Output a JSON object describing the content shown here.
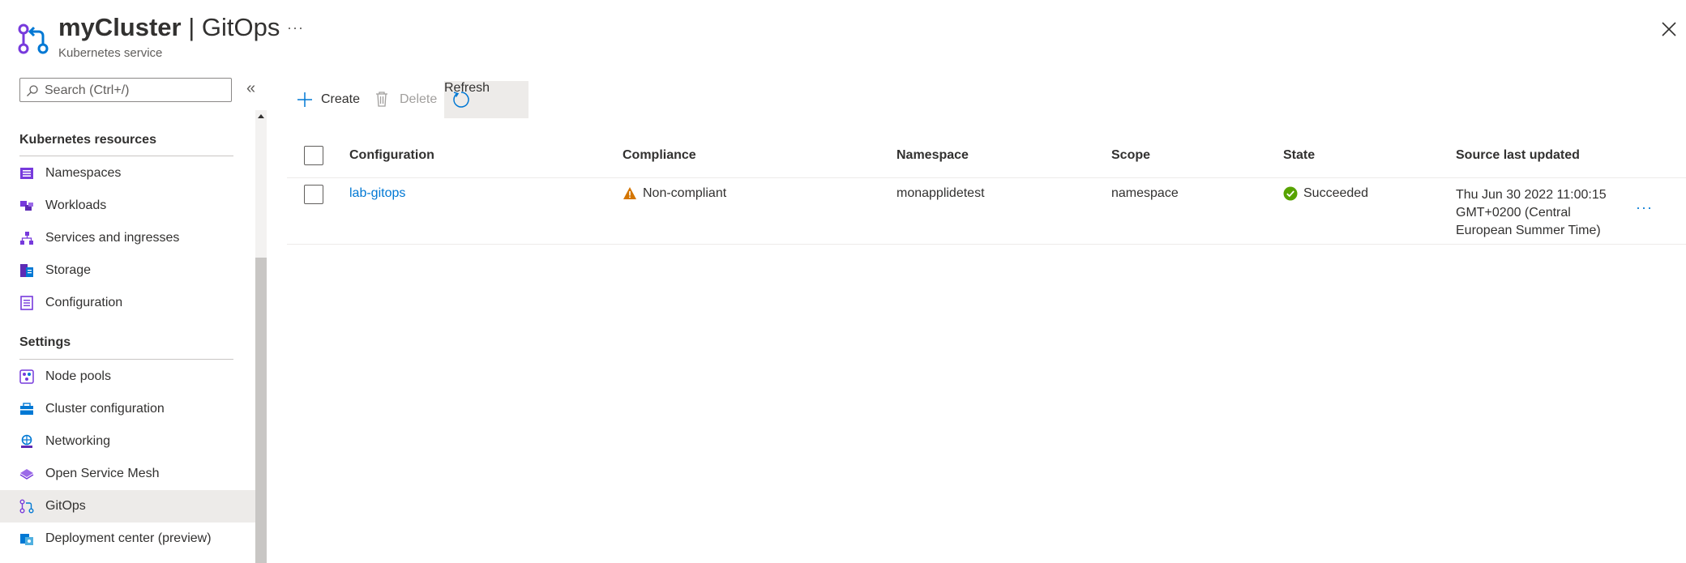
{
  "header": {
    "resource_name": "myCluster",
    "separator": " | ",
    "page_name": "GitOps",
    "subtitle": "Kubernetes service",
    "more": "···"
  },
  "sidebar": {
    "search_placeholder": "Search (Ctrl+/)",
    "collapse": "«",
    "sections": [
      {
        "title": "Kubernetes resources",
        "items": [
          {
            "label": "Namespaces",
            "icon": "namespaces-icon"
          },
          {
            "label": "Workloads",
            "icon": "workloads-icon"
          },
          {
            "label": "Services and ingresses",
            "icon": "services-icon"
          },
          {
            "label": "Storage",
            "icon": "storage-icon"
          },
          {
            "label": "Configuration",
            "icon": "configuration-icon"
          }
        ]
      },
      {
        "title": "Settings",
        "items": [
          {
            "label": "Node pools",
            "icon": "node-pools-icon"
          },
          {
            "label": "Cluster configuration",
            "icon": "cluster-configuration-icon"
          },
          {
            "label": "Networking",
            "icon": "networking-icon"
          },
          {
            "label": "Open Service Mesh",
            "icon": "open-service-mesh-icon"
          },
          {
            "label": "GitOps",
            "icon": "gitops-icon",
            "active": true
          },
          {
            "label": "Deployment center (preview)",
            "icon": "deployment-center-icon"
          }
        ]
      }
    ]
  },
  "toolbar": {
    "create_label": "Create",
    "delete_label": "Delete",
    "refresh_label": "Refresh"
  },
  "grid": {
    "columns": [
      "Configuration",
      "Compliance",
      "Namespace",
      "Scope",
      "State",
      "Source last updated"
    ],
    "rows": [
      {
        "configuration": "lab-gitops",
        "compliance": "Non-compliant",
        "namespace": "monapplidetest",
        "scope": "namespace",
        "state": "Succeeded",
        "source_last_updated": [
          "Thu Jun 30 2022 11:00:15",
          "GMT+0200 (Central",
          "European Summer Time)"
        ],
        "more": "···"
      }
    ]
  },
  "colors": {
    "accent": "#0078d4",
    "purple": "#773adc",
    "warning": "#d47500",
    "success": "#57a300"
  }
}
